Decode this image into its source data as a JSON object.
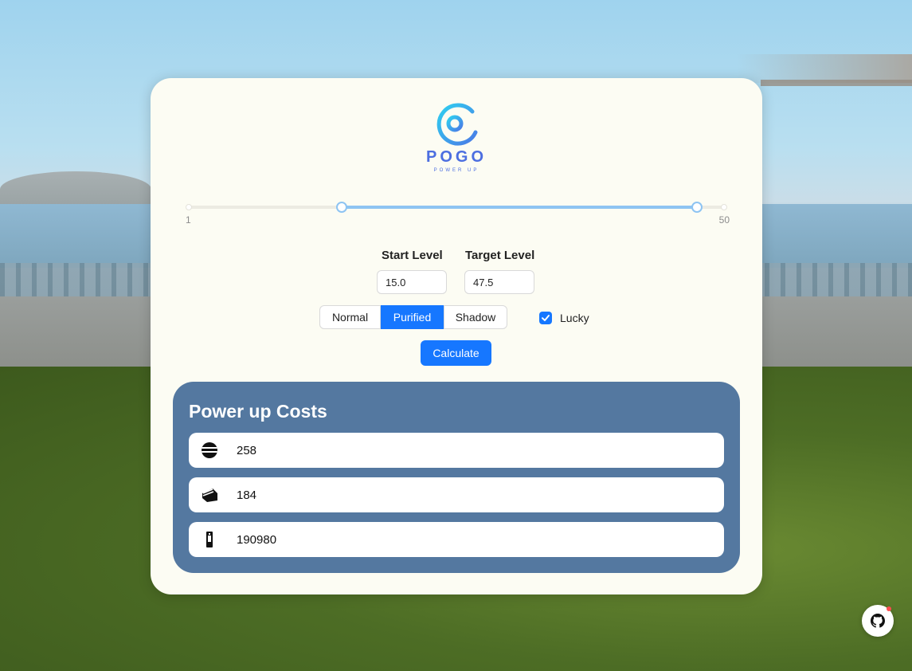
{
  "app": {
    "logo_title": "POGO",
    "logo_subtitle": "POWER UP"
  },
  "level_slider": {
    "min_label": "1",
    "max_label": "50",
    "min": 1,
    "max": 50,
    "start_value": 15.0,
    "target_value": 47.5
  },
  "form": {
    "start_label": "Start Level",
    "start_value": "15.0",
    "target_label": "Target Level",
    "target_value": "47.5"
  },
  "type_options": [
    {
      "label": "Normal",
      "selected": false
    },
    {
      "label": "Purified",
      "selected": true
    },
    {
      "label": "Shadow",
      "selected": false
    }
  ],
  "lucky": {
    "label": "Lucky",
    "checked": true
  },
  "calculate_label": "Calculate",
  "costs": {
    "title": "Power up Costs",
    "rows": [
      {
        "icon": "rare-candy-icon",
        "value": "258"
      },
      {
        "icon": "candy-xl-icon",
        "value": "184"
      },
      {
        "icon": "stardust-icon",
        "value": "190980"
      }
    ]
  },
  "colors": {
    "accent": "#1677ff",
    "panel": "#5478a0",
    "slider": "#8ec4f2",
    "logo": "#4c6ee0"
  },
  "github": {
    "icon": "github-icon"
  }
}
